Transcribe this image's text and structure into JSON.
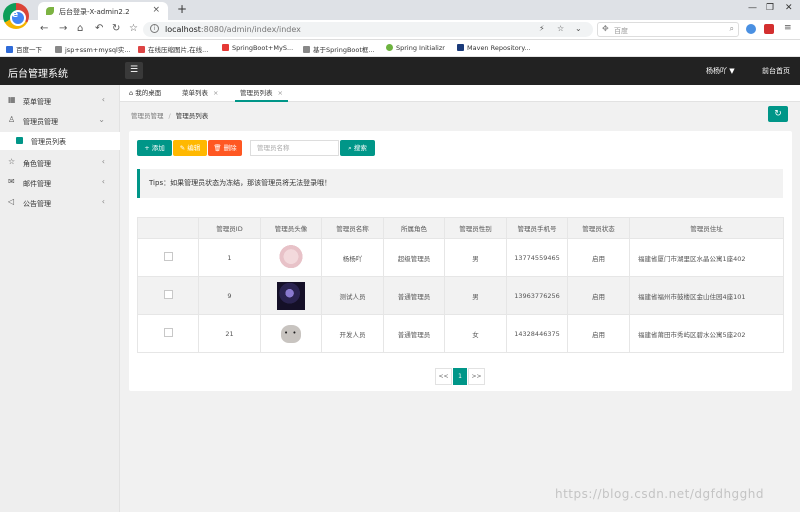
{
  "browser": {
    "tab_title": "后台登录-X-admin2.2",
    "url_host": "localhost",
    "url_rest": ":8080/admin/index/index",
    "search_placeholder": "百度",
    "bookmarks": [
      "百度一下",
      "jsp+ssm+mysql实...",
      "在线压缩图片,在线...",
      "SpringBoot+MyS...",
      "基于SpringBoot框...",
      "Spring Initializr",
      "Maven Repository..."
    ],
    "bookmark_colors": [
      "#2f6bd8",
      "#888888",
      "#d44",
      "#e53935",
      "#888888",
      "#6db33f",
      "#1a3a7a"
    ]
  },
  "header": {
    "app_title": "后台管理系统",
    "user_name": "杨杨吖 ▼",
    "home_link": "前台首页"
  },
  "sidebar": {
    "items": [
      {
        "label": "菜单管理",
        "icon": "grid-icon"
      },
      {
        "label": "管理员管理",
        "icon": "user-icon"
      },
      {
        "label": "角色管理",
        "icon": "star-icon"
      },
      {
        "label": "邮件管理",
        "icon": "mail-icon"
      },
      {
        "label": "公告管理",
        "icon": "speaker-icon"
      }
    ],
    "sub_item": "管理员列表"
  },
  "page_tabs": [
    "我的桌面",
    "菜单列表",
    "管理员列表"
  ],
  "breadcrumb": {
    "parent": "管理员管理",
    "current": "管理员列表"
  },
  "toolbar": {
    "add_label": "添加",
    "edit_label": "编辑",
    "delete_label": "删除",
    "search_placeholder": "管理员名称",
    "search_label": "搜索"
  },
  "tips": "Tips：如果管理员状态为冻结，那该管理员将无法登录哦！",
  "table": {
    "headers": [
      "",
      "管理员ID",
      "管理员头像",
      "管理员名称",
      "所属角色",
      "管理员性别",
      "管理员手机号",
      "管理员状态",
      "管理员住址"
    ],
    "rows": [
      {
        "id": "1",
        "name": "杨杨吖",
        "role": "超级管理员",
        "gender": "男",
        "phone": "13774559465",
        "status": "启用",
        "address": "福建省厦门市湖里区水晶公寓1座402"
      },
      {
        "id": "9",
        "name": "测试人员",
        "role": "普通管理员",
        "gender": "男",
        "phone": "13963776256",
        "status": "启用",
        "address": "福建省福州市鼓楼区金山住园4座101"
      },
      {
        "id": "21",
        "name": "开发人员",
        "role": "普通管理员",
        "gender": "女",
        "phone": "14328446375",
        "status": "启用",
        "address": "福建省莆田市秀屿区碧水公寓5座202"
      }
    ]
  },
  "pagination": {
    "prev": "<<",
    "current": "1",
    "next": ">>"
  },
  "watermark": "https://blog.csdn.net/dgfdhgghd"
}
